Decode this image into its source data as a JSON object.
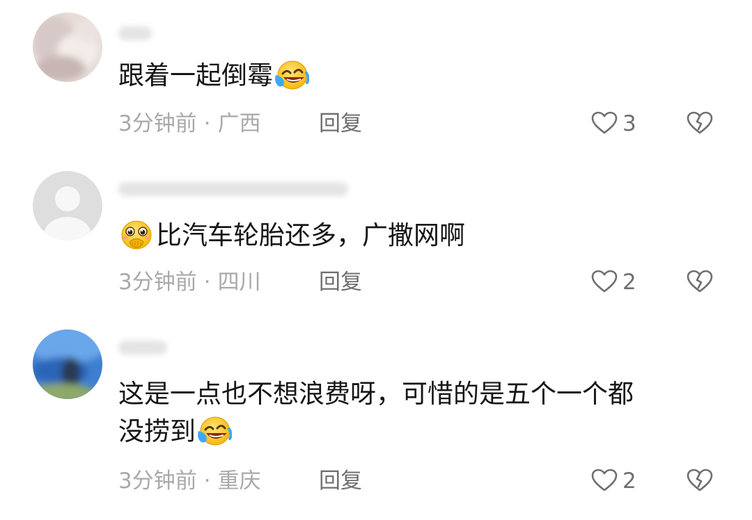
{
  "comments": [
    {
      "text": "跟着一起倒霉",
      "text_emoji": "laugh-cry-emoji",
      "time": "3分钟前",
      "location": "广西",
      "reply_label": "回复",
      "likes": "3"
    },
    {
      "lead_emoji": "pleading-cover-mouth-emoji",
      "text": "比汽车轮胎还多，广撒网啊",
      "time": "3分钟前",
      "location": "四川",
      "reply_label": "回复",
      "likes": "2"
    },
    {
      "text_line1": "这是一点也不想浪费呀，可惜的是五个一个都",
      "text_line2": "没捞到",
      "text_emoji": "laugh-cry-emoji",
      "time": "3分钟前",
      "location": "重庆",
      "reply_label": "回复",
      "likes": "2"
    }
  ],
  "icons": {
    "like": "heart-outline-icon",
    "dislike": "broken-heart-icon"
  },
  "colors": {
    "text": "#161616",
    "meta": "#a9a9a9",
    "action": "#6f6f6f"
  }
}
